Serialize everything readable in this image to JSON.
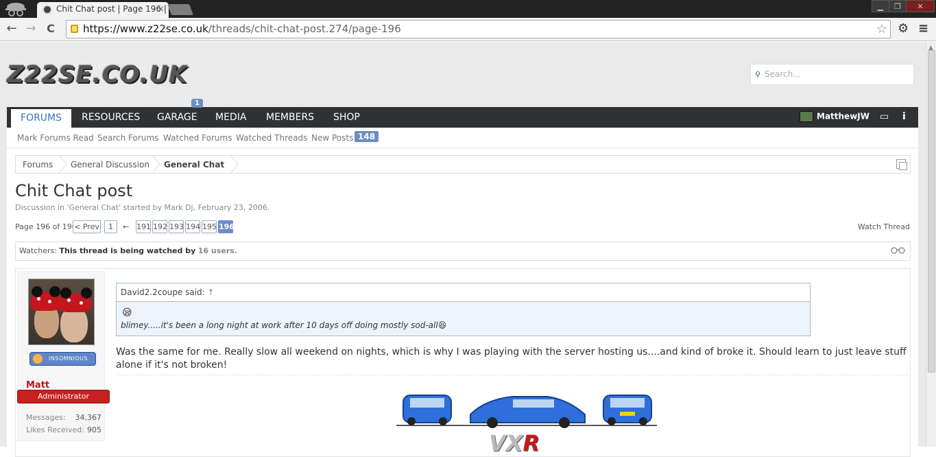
{
  "browser": {
    "tab_title": "Chit Chat post | Page 196 |",
    "tab_close": "×",
    "url_host": "https://www.z22se.co.uk",
    "url_path": "/threads/chit-chat-post.274/page-196",
    "window_buttons": [
      "▁",
      "❐",
      "✕"
    ],
    "icons": {
      "back": "←",
      "forward": "→",
      "reload": "C",
      "star": "☆",
      "gear": "⚙",
      "menu": "≡"
    }
  },
  "site": {
    "logo": "Z22SE.CO.UK",
    "search_placeholder": "Search...",
    "search_icon": "🔍"
  },
  "nav": {
    "tabs": [
      "FORUMS",
      "RESOURCES",
      "GARAGE",
      "MEDIA",
      "MEMBERS",
      "SHOP"
    ],
    "garage_badge": "1",
    "username": "MatthewJW",
    "inbox_icon": "▭",
    "info_icon": "i"
  },
  "subnav": {
    "items": [
      "Mark Forums Read",
      "Search Forums",
      "Watched Forums",
      "Watched Threads",
      "New Posts"
    ],
    "new_posts_count": "148"
  },
  "breadcrumb": [
    "Forums",
    "General Discussion",
    "General Chat"
  ],
  "thread": {
    "title": "Chit Chat post",
    "meta": "Discussion in 'General Chat' started by Mark Dj, February 23, 2006.",
    "page_label": "Page 196 of 196",
    "prev": "< Prev",
    "first": "1",
    "ellipsis": "←",
    "pages": [
      "191",
      "192",
      "193",
      "194",
      "195",
      "196"
    ],
    "watch": "Watch Thread",
    "watchers_label": "Watchers:",
    "watchers_text": "This thread is being watched by",
    "watchers_count": "16 users.",
    "watchers_icon": "👓"
  },
  "post": {
    "username": "Matt",
    "role": "Administrator",
    "badge": "INSOMNIOUS",
    "stats": [
      {
        "label": "Messages:",
        "value": "34,367"
      },
      {
        "label": "Likes Received:",
        "value": "905"
      }
    ],
    "quote_author": "David2.2coupe said:",
    "quote_arrow": "↑",
    "quote_emoji": "😪",
    "quote_text": "blimey.....it's been a long night at work after 10 days off doing mostly sod-all",
    "quote_end_emoji": "😆",
    "message": "Was the same for me. Really slow all weekend on nights, which is why I was playing with the server hosting us....and kind of broke it. Should learn to just leave stuff alone if it's not broken!",
    "signature_logo": "VX",
    "signature_logo_r": "R"
  }
}
